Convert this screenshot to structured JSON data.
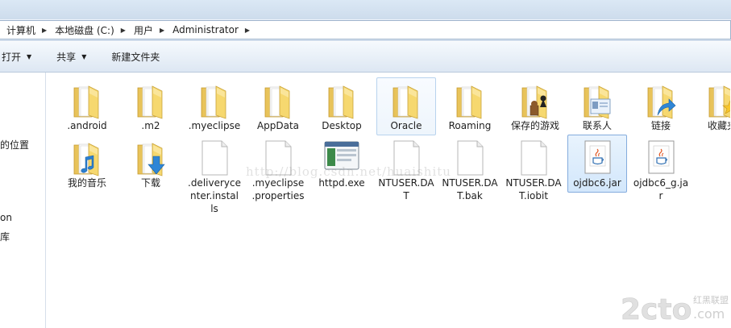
{
  "breadcrumb": [
    "计算机",
    "本地磁盘 (C:)",
    "用户",
    "Administrator"
  ],
  "toolbar": {
    "open_label": "打开",
    "share_label": "共享",
    "new_folder_label": "新建文件夹"
  },
  "nav": {
    "item_1": "的位置",
    "item_2": "on",
    "item_3": "库"
  },
  "files": [
    {
      "label": ".android",
      "icon": "folder-icon"
    },
    {
      "label": ".m2",
      "icon": "folder-icon"
    },
    {
      "label": ".myeclipse",
      "icon": "folder-icon"
    },
    {
      "label": "AppData",
      "icon": "folder-icon"
    },
    {
      "label": "Desktop",
      "icon": "folder-icon"
    },
    {
      "label": "Oracle",
      "icon": "folder-icon"
    },
    {
      "label": "Roaming",
      "icon": "folder-icon"
    },
    {
      "label": "保存的游戏",
      "icon": "saved-games-folder-icon"
    },
    {
      "label": "联系人",
      "icon": "contacts-folder-icon"
    },
    {
      "label": "链接",
      "icon": "links-folder-icon"
    },
    {
      "label": "收藏夹",
      "icon": "favorites-folder-icon"
    },
    {
      "label": "我的音乐",
      "icon": "music-folder-icon"
    },
    {
      "label": "下载",
      "icon": "downloads-folder-icon"
    },
    {
      "label": ".deliverycenter.installs",
      "icon": "file-icon"
    },
    {
      "label": ".myeclipse.properties",
      "icon": "file-icon"
    },
    {
      "label": "httpd.exe",
      "icon": "exe-icon"
    },
    {
      "label": "NTUSER.DAT",
      "icon": "file-icon"
    },
    {
      "label": "NTUSER.DAT.bak",
      "icon": "file-icon"
    },
    {
      "label": "NTUSER.DAT.iobit",
      "icon": "file-icon"
    },
    {
      "label": "ojdbc6.jar",
      "icon": "jar-icon"
    },
    {
      "label": "ojdbc6_g.jar",
      "icon": "jar-icon"
    }
  ],
  "watermark": "http://blog.csdn.net/huaishitu",
  "logo": {
    "brand": "2cto",
    "domain": ".com",
    "tagline": "红黑联盟"
  }
}
